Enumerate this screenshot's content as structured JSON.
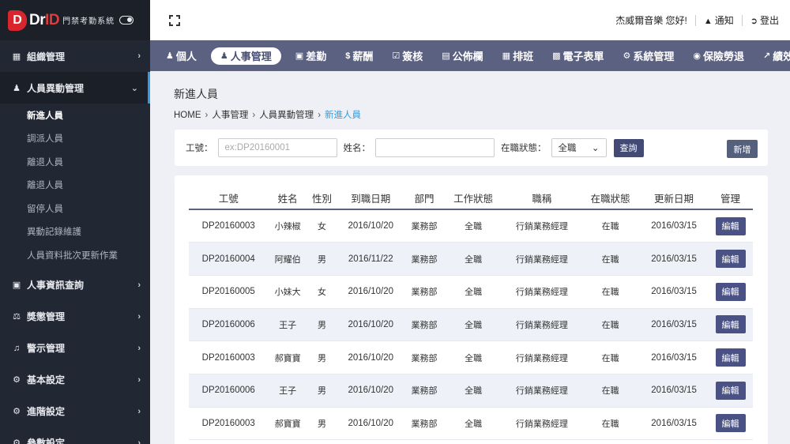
{
  "brand": {
    "logo_letter": "D",
    "name_a": "Dr",
    "name_b": "ID",
    "subtitle": "門禁考勤系統"
  },
  "sidebar": {
    "items": [
      {
        "label": "組織管理",
        "icon": "sitemap-icon"
      },
      {
        "label": "人員異動管理",
        "icon": "user-edit-icon"
      },
      {
        "label": "人事資訊查詢",
        "icon": "id-card-icon"
      },
      {
        "label": "獎懲管理",
        "icon": "balance-scale-icon"
      },
      {
        "label": "警示管理",
        "icon": "bell-icon"
      },
      {
        "label": "基本設定",
        "icon": "gear-icon"
      },
      {
        "label": "進階設定",
        "icon": "gear-icon"
      },
      {
        "label": "參數設定",
        "icon": "gear-icon"
      }
    ],
    "subitems": [
      "新進人員",
      "調派人員",
      "離退人員",
      "離退人員",
      "留停人員",
      "異動記錄維護",
      "人員資料批次更新作業"
    ]
  },
  "topbar": {
    "greeting": "杰威爾音樂 您好!",
    "notify": "通知",
    "logout": "登出"
  },
  "nav": {
    "tabs": [
      "個人",
      "人事管理",
      "差勤",
      "薪酬",
      "簽核",
      "公佈欄",
      "排班",
      "電子表單",
      "系統管理",
      "保險勞退",
      "績效"
    ]
  },
  "page": {
    "title": "新進人員"
  },
  "breadcrumb": [
    "HOME",
    "人事管理",
    "人員異動管理",
    "新進人員"
  ],
  "filter": {
    "id_label": "工號：",
    "id_placeholder": "ex:DP20160001",
    "name_label": "姓名：",
    "name_value": "",
    "status_label": "在職狀態：",
    "status_value": "全職",
    "query_button": "查詢",
    "add_button": "新增"
  },
  "table": {
    "headers": [
      "工號",
      "姓名",
      "性別",
      "到職日期",
      "部門",
      "工作狀態",
      "職稱",
      "在職狀態",
      "更新日期",
      "管理"
    ],
    "edit_label": "編輯",
    "rows": [
      [
        "DP20160003",
        "小辣椒",
        "女",
        "2016/10/20",
        "業務部",
        "全職",
        "行銷業務經理",
        "在職",
        "2016/03/15"
      ],
      [
        "DP20160004",
        "阿耀伯",
        "男",
        "2016/11/22",
        "業務部",
        "全職",
        "行銷業務經理",
        "在職",
        "2016/03/15"
      ],
      [
        "DP20160005",
        "小妹大",
        "女",
        "2016/10/20",
        "業務部",
        "全職",
        "行銷業務經理",
        "在職",
        "2016/03/15"
      ],
      [
        "DP20160006",
        "王子",
        "男",
        "2016/10/20",
        "業務部",
        "全職",
        "行銷業務經理",
        "在職",
        "2016/03/15"
      ],
      [
        "DP20160003",
        "郝寶寶",
        "男",
        "2016/10/20",
        "業務部",
        "全職",
        "行銷業務經理",
        "在職",
        "2016/03/15"
      ],
      [
        "DP20160006",
        "王子",
        "男",
        "2016/10/20",
        "業務部",
        "全職",
        "行銷業務經理",
        "在職",
        "2016/03/15"
      ],
      [
        "DP20160003",
        "郝寶寶",
        "男",
        "2016/10/20",
        "業務部",
        "全職",
        "行銷業務經理",
        "在職",
        "2016/03/15"
      ]
    ]
  }
}
